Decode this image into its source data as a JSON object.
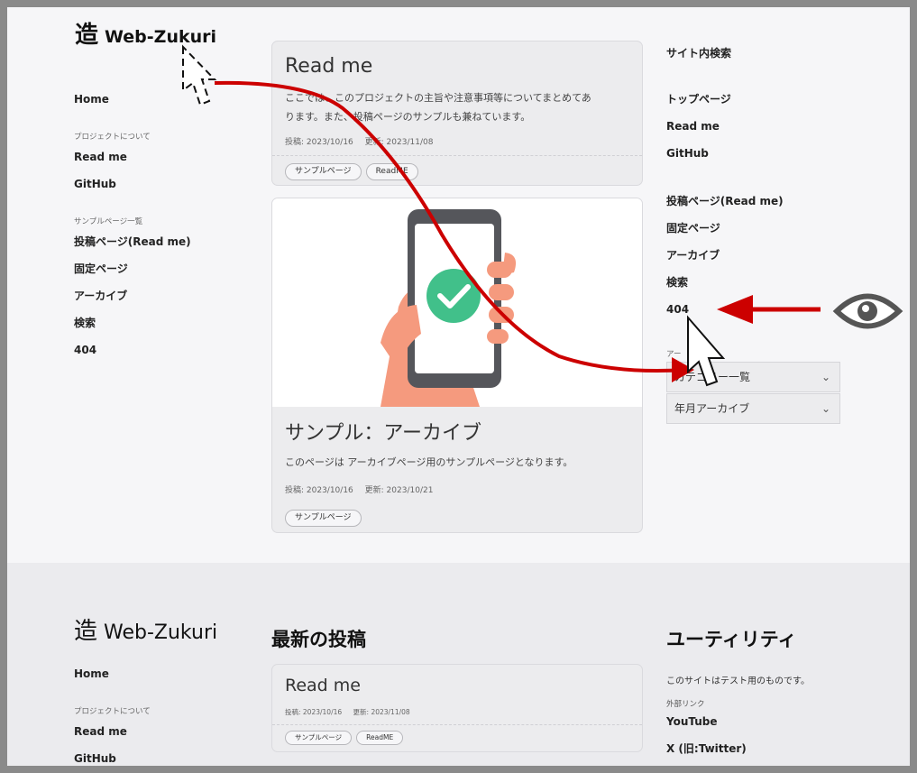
{
  "logo": {
    "kanji": "造",
    "name": "Web-Zukuri"
  },
  "left_nav": {
    "home": "Home",
    "project_caption": "プロジェクトについて",
    "project_items": [
      "Read me",
      "GitHub"
    ],
    "sample_caption": "サンプルページ一覧",
    "sample_items": [
      "投稿ページ(Read me)",
      "固定ページ",
      "アーカイブ",
      "検索",
      "404"
    ]
  },
  "posts": [
    {
      "title": "Read me",
      "desc_line1": "ここでは、このプロジェクトの主旨や注意事項等についてまとめてあ",
      "desc_line2": "ります。また、投稿ページのサンプルも兼ねています。",
      "posted": "投稿: 2023/10/16",
      "updated": "更新: 2023/11/08",
      "tags": [
        "サンプルページ",
        "ReadME"
      ]
    },
    {
      "title": "サンプル：アーカイブ",
      "desc": "このページは アーカイブページ用のサンプルページとなります。",
      "posted": "投稿: 2023/10/16",
      "updated": "更新: 2023/10/21",
      "tags": [
        "サンプルページ"
      ],
      "image_icon": "phone-check-icon"
    }
  ],
  "right_sidebar": {
    "search_title": "サイト内検索",
    "links1": [
      "トップページ",
      "Read me",
      "GitHub"
    ],
    "links2": [
      "投稿ページ(Read me)",
      "固定ページ",
      "アーカイブ",
      "検索",
      "404"
    ],
    "archive_caption": "アー",
    "category_select": "カテゴリー一覧",
    "month_select": "年月アーカイブ"
  },
  "footer": {
    "logo_kanji": "造",
    "logo_name": "Web-Zukuri",
    "home": "Home",
    "project_caption": "プロジェクトについて",
    "project_items": [
      "Read me",
      "GitHub"
    ],
    "latest_title": "最新の投稿",
    "latest_post": {
      "title": "Read me",
      "posted": "投稿: 2023/10/16",
      "updated": "更新: 2023/11/08",
      "tags": [
        "サンプルページ",
        "ReadME"
      ]
    },
    "utility_title": "ユーティリティ",
    "utility_text": "このサイトはテスト用のものです。",
    "external_caption": "外部リンク",
    "external_links": [
      "YouTube",
      "X (旧:Twitter)"
    ]
  },
  "annotations": {
    "arrow_color": "#cc0000",
    "eye_icon": "eye-icon",
    "cursor_icons": [
      "cursor-icon"
    ]
  }
}
